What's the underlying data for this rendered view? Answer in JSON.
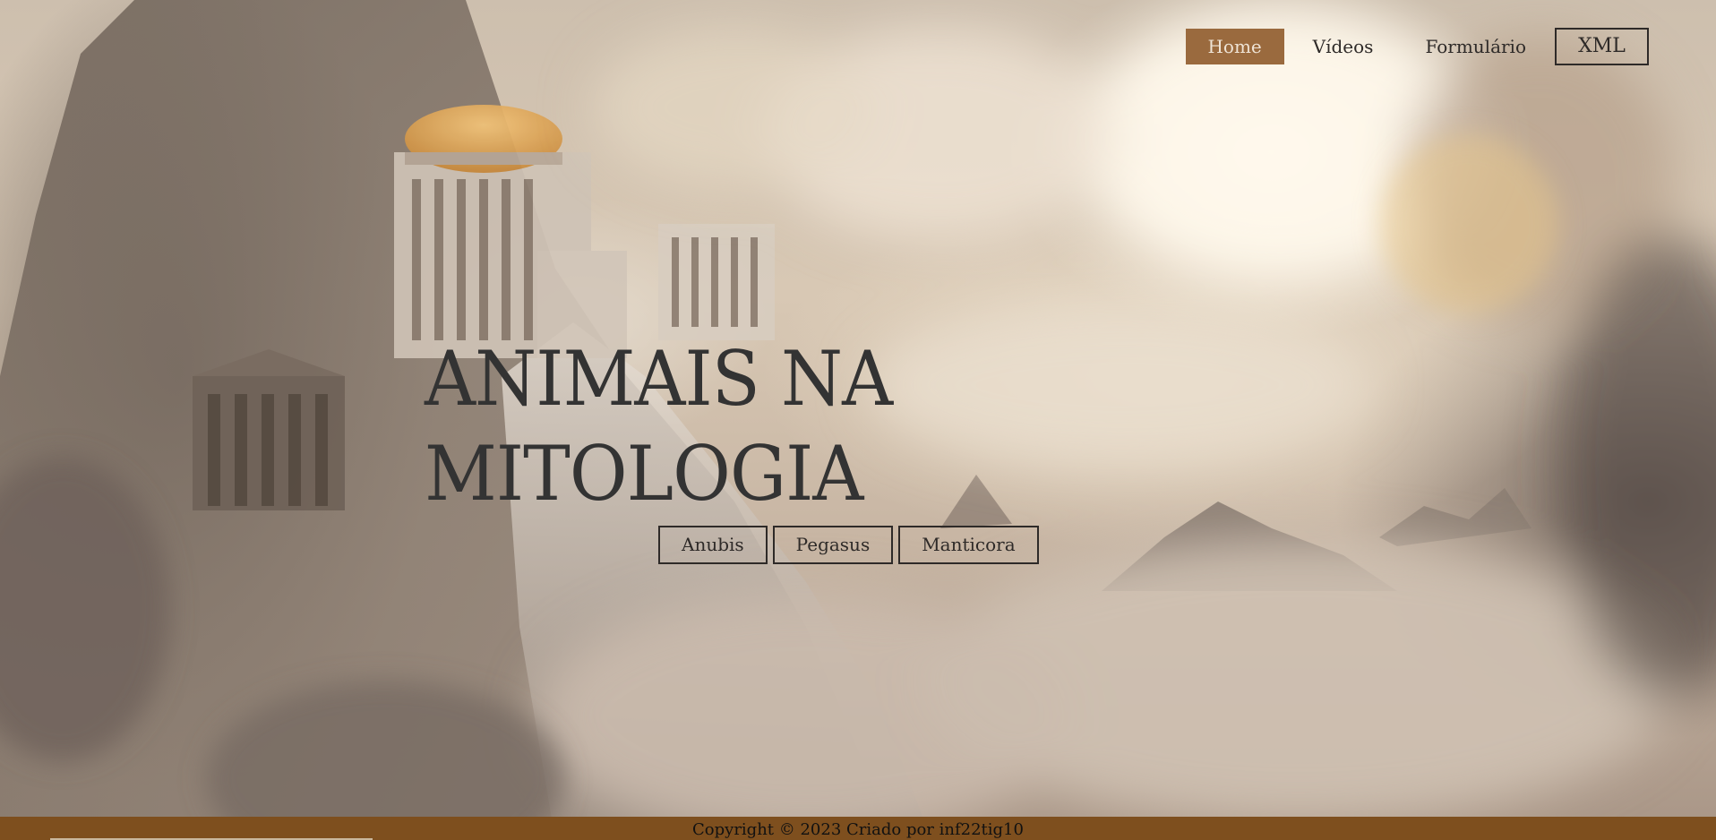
{
  "nav": {
    "home": "Home",
    "videos": "Vídeos",
    "form": "Formulário",
    "xml": "XML"
  },
  "hero": {
    "title_line1": "ANIMAIS NA",
    "title_line2": "MITOLOGIA"
  },
  "animals": [
    "Anubis",
    "Pegasus",
    "Manticora"
  ],
  "footer": {
    "copyright": "Copyright © 2023 Criado por inf22tig10"
  },
  "colors": {
    "accent": "#9a6a3e",
    "footer": "#7e4f1e",
    "text": "#333333"
  },
  "background": {
    "icon": "mountain-temple-clouds-image"
  }
}
